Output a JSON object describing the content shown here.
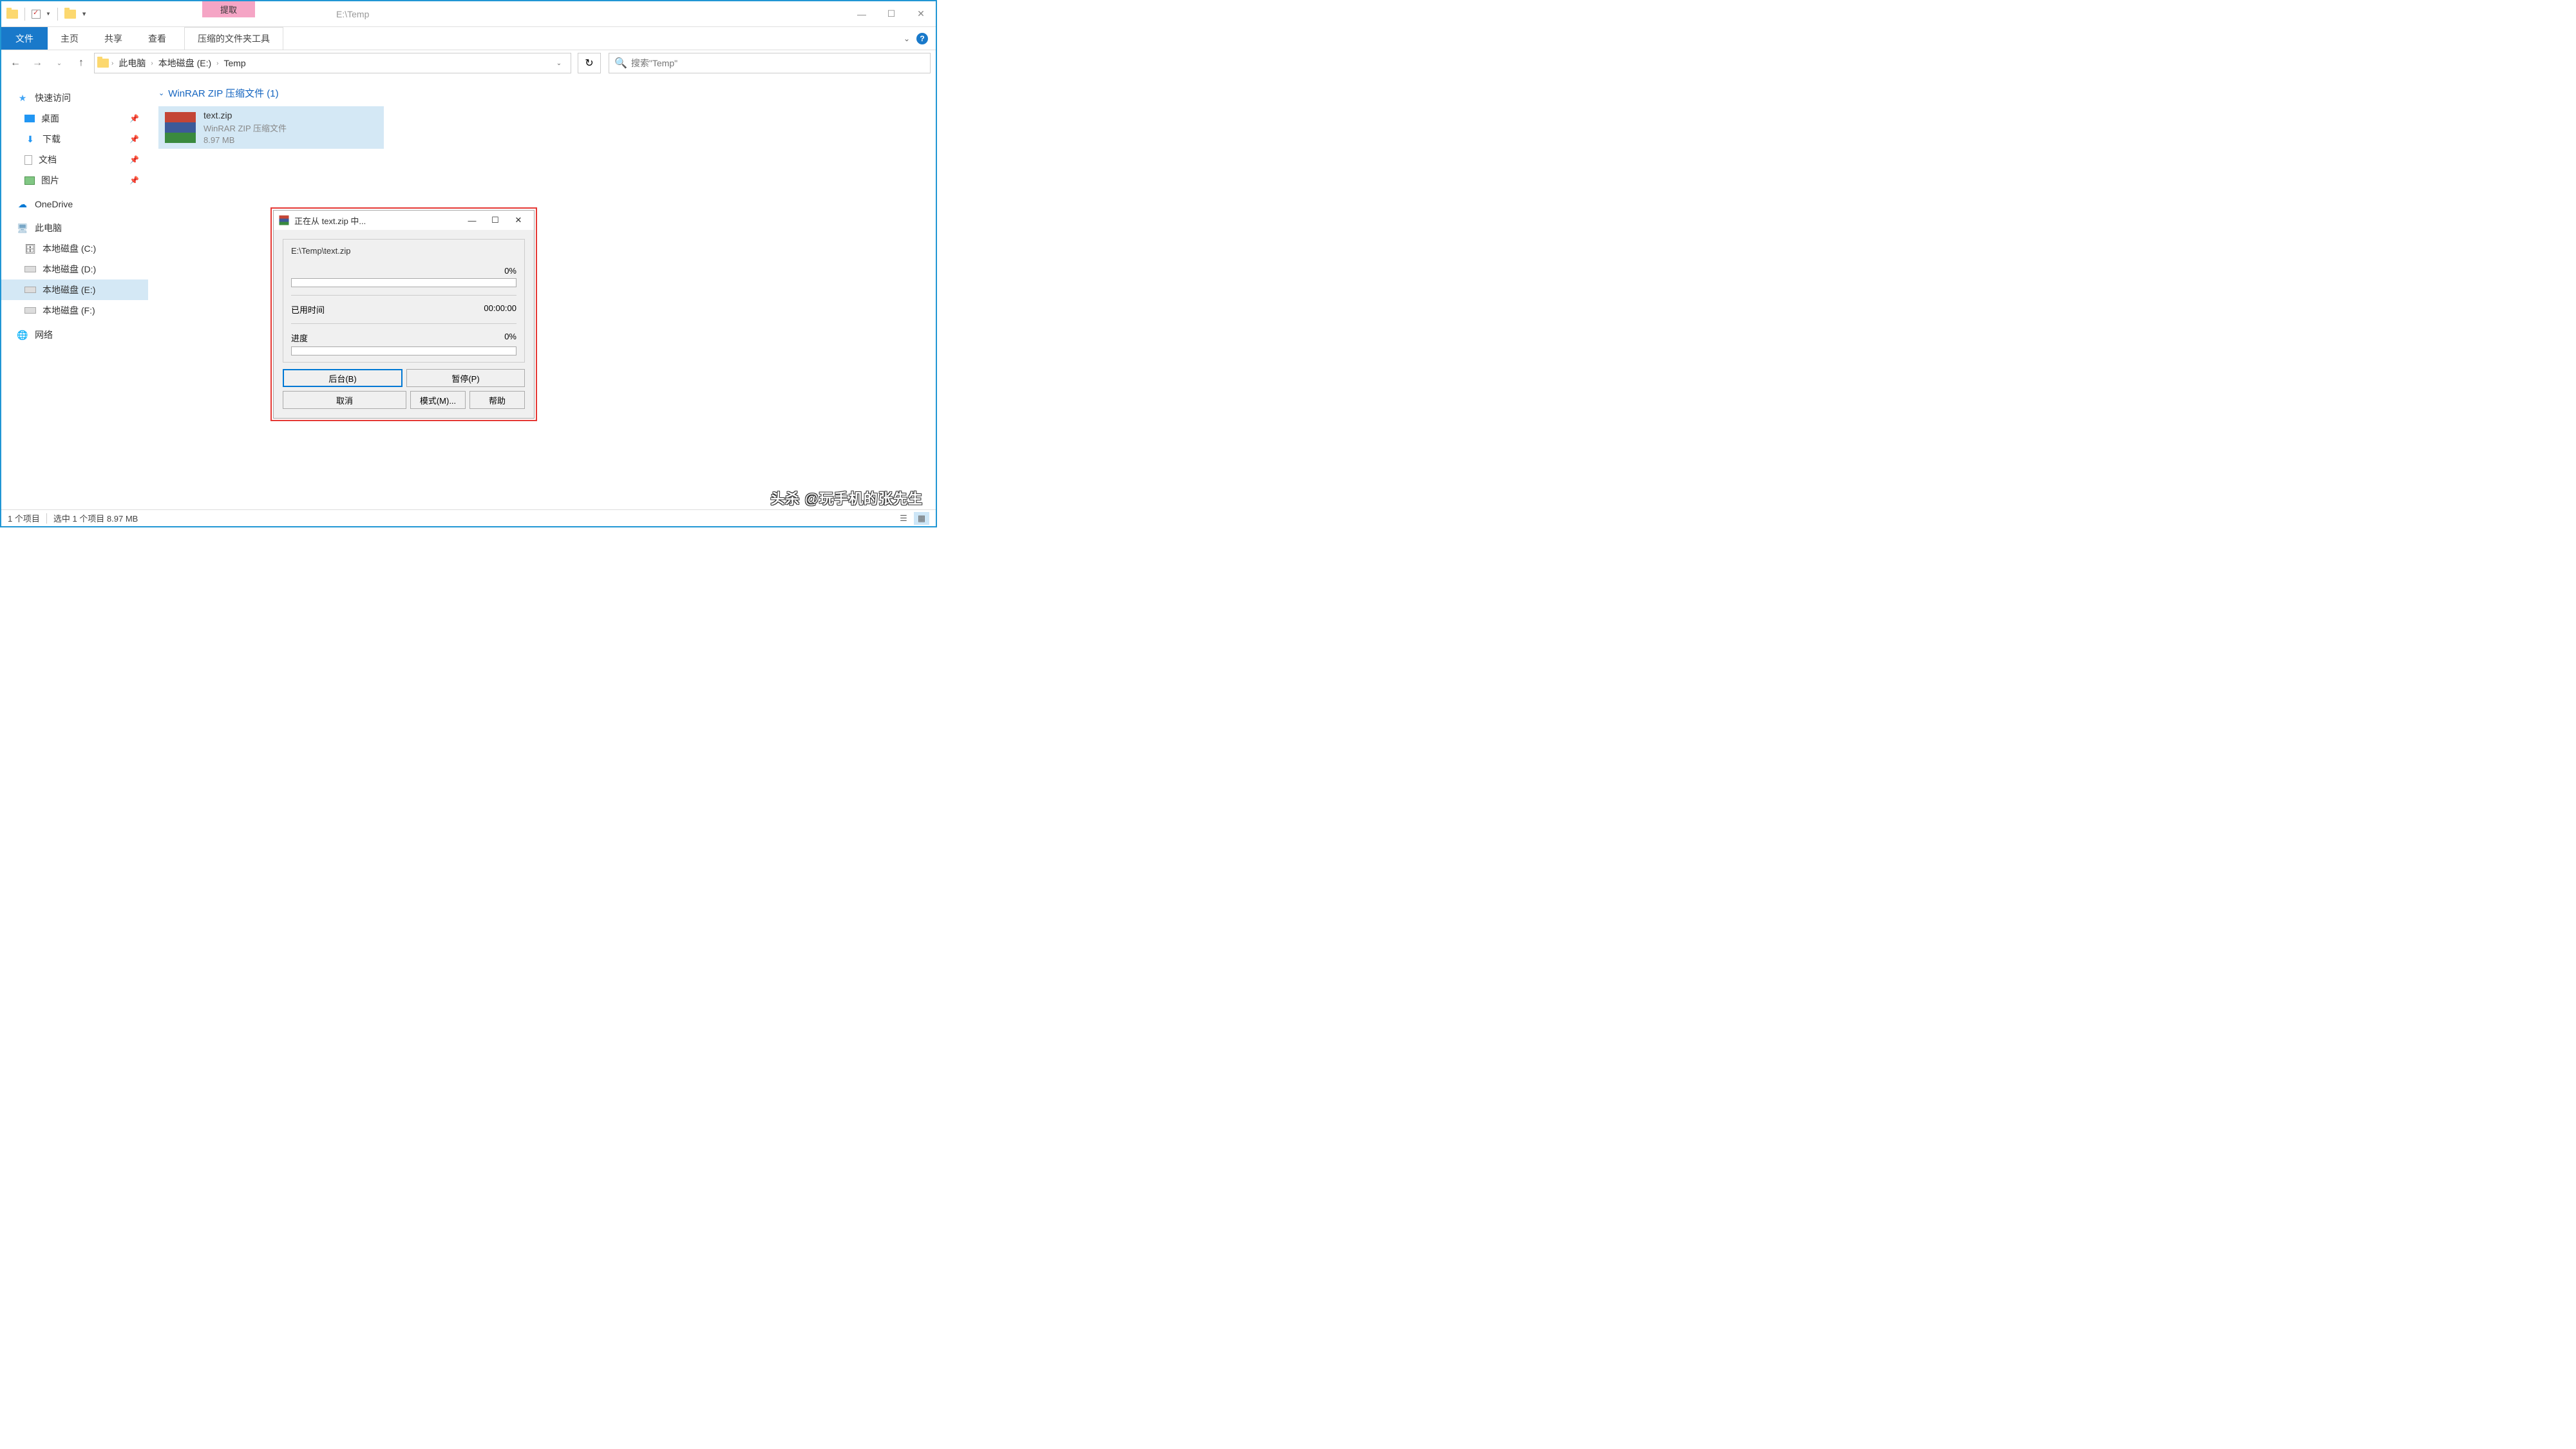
{
  "titlebar": {
    "context_tab": "提取",
    "window_title": "E:\\Temp"
  },
  "ribbon": {
    "file": "文件",
    "home": "主页",
    "share": "共享",
    "view": "查看",
    "compressed": "压缩的文件夹工具"
  },
  "breadcrumb": {
    "items": [
      "此电脑",
      "本地磁盘 (E:)",
      "Temp"
    ]
  },
  "search": {
    "placeholder": "搜索\"Temp\""
  },
  "sidebar": {
    "quick_access": "快速访问",
    "desktop": "桌面",
    "downloads": "下载",
    "documents": "文档",
    "pictures": "图片",
    "onedrive": "OneDrive",
    "this_pc": "此电脑",
    "drive_c": "本地磁盘 (C:)",
    "drive_d": "本地磁盘 (D:)",
    "drive_e": "本地磁盘 (E:)",
    "drive_f": "本地磁盘 (F:)",
    "network": "网络"
  },
  "content": {
    "group_header": "WinRAR ZIP 压缩文件 (1)",
    "file": {
      "name": "text.zip",
      "type": "WinRAR ZIP 压缩文件",
      "size": "8.97 MB"
    }
  },
  "dialog": {
    "title": "正在从 text.zip 中...",
    "path": "E:\\Temp\\text.zip",
    "percent": "0%",
    "elapsed_label": "已用时间",
    "elapsed_value": "00:00:00",
    "progress_label": "进度",
    "progress_value": "0%",
    "buttons": {
      "background": "后台(B)",
      "pause": "暂停(P)",
      "cancel": "取消",
      "mode": "模式(M)...",
      "help": "帮助"
    }
  },
  "statusbar": {
    "items": "1 个项目",
    "selected": "选中 1 个项目 8.97 MB"
  },
  "watermark": "头杀 @玩手机的张先生"
}
